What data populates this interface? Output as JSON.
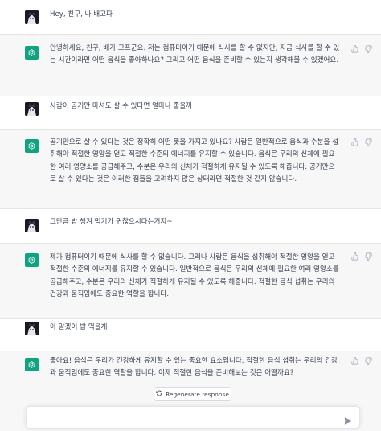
{
  "messages": [
    {
      "role": "user",
      "text": "Hey, 친구, 나 배고파"
    },
    {
      "role": "assistant",
      "text": "안녕하세요, 친구, 배가 고프군요. 저는 컴퓨터이기 때문에 식사를 할 수 없지만, 지금 식사를 할 수 있는 시간이라면 어떤 음식을 좋아하나요? 그리고 어떤 음식을 준비할 수 있는지 생각해볼 수 있겠어요."
    },
    {
      "role": "user",
      "text": "사람이 공기만 마셔도 살 수 있다면 얼마나 좋을까"
    },
    {
      "role": "assistant",
      "text": "공기만으로 살 수 있다는 것은 정확히 어떤 뜻을 가지고 있나요? 사람은 일반적으로 음식과 수분을 섭취해야 적절한 영양을 얻고 적절한 수준의 에너지를 유지할 수 있습니다. 음식은 우리의 신체에 필요한 여러 영양소를 공급해주고, 수분은 우리의 신체가 적절하게 유지될 수 있도록 해줍니다. 공기만으로 살 수 있다는 것은 이러한 점들을 고려하지 않은 상태라면 적절한 것 같지 않습니다."
    },
    {
      "role": "user",
      "text": "그만큼 밥 챙겨 먹기가 귀찮으시다는거지~"
    },
    {
      "role": "assistant",
      "text": "제가 컴퓨터이기 때문에 식사를 할 수 없습니다. 그러나 사람은 음식을 섭취해야 적절한 영양을 얻고 적절한 수준의 에너지를 유지할 수 있습니다. 일반적으로 음식은 우리의 신체에 필요한 여러 영양소를 공급해주고, 수분은 우리의 신체가 적절하게 유지될 수 있도록 해줍니다. 적절한 음식 섭취는 우리의 건강과 움직임에도 중요한 역할을 합니다."
    },
    {
      "role": "user",
      "text": "아 알겠어 밥 먹을게"
    },
    {
      "role": "assistant",
      "text": "좋아요! 음식은 우리가 건강하게 유지할 수 있는 중요한 요소입니다. 적절한 음식 섭취는 우리의 건강과 움직임에도 중요한 역할을 합니다. 이제 적절한 음식을 준비해보는 것은 어떨까요?"
    }
  ],
  "icons": {
    "assistant_avatar": "openai-logo-icon",
    "user_avatar": "user-avatar-image",
    "thumbs_up": "thumbs-up-icon",
    "thumbs_down": "thumbs-down-icon",
    "regenerate": "refresh-icon",
    "send": "paper-plane-icon"
  },
  "regenerate_label": "Regenerate response",
  "composer": {
    "value": "",
    "placeholder": ""
  },
  "colors": {
    "assistant_bg": "#f7f7f8",
    "accent": "#10a37f",
    "user_avatar_bg": "#1b1a22"
  }
}
